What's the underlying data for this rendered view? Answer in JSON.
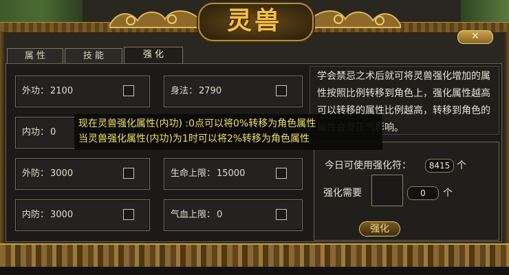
{
  "title": "灵兽",
  "close_label": "✕",
  "tabs": [
    {
      "label": "属 性"
    },
    {
      "label": "技 能"
    },
    {
      "label": "强 化"
    }
  ],
  "attributes": [
    {
      "label": "外功：",
      "value": "2100"
    },
    {
      "label": "内功：",
      "value": "0"
    },
    {
      "label": "外防：",
      "value": "3000"
    },
    {
      "label": "内防：",
      "value": "3000"
    },
    {
      "label": "身法：",
      "value": "2790"
    },
    {
      "label": "生命上限：",
      "value": "15000"
    },
    {
      "label": "气血上限：",
      "value": "0"
    }
  ],
  "description": "学会禁忌之术后就可将灵兽强化增加的属性按照比例转移到角色上，强化属性越高可以转移的属性比例越高，转移到角色的属性会受正气影响。",
  "tooltip": {
    "line1": "现在灵兽强化属性(内功) :0点可以将0%转移为角色属性",
    "line2": "当灵兽强化属性(内功)为1时可以将2%转移为角色属性"
  },
  "panel": {
    "daily_label": "今日可使用强化符：",
    "daily_value": "8415",
    "unit": "个",
    "need_label": "强化需要",
    "need_value": "0",
    "button_label": "强化"
  }
}
